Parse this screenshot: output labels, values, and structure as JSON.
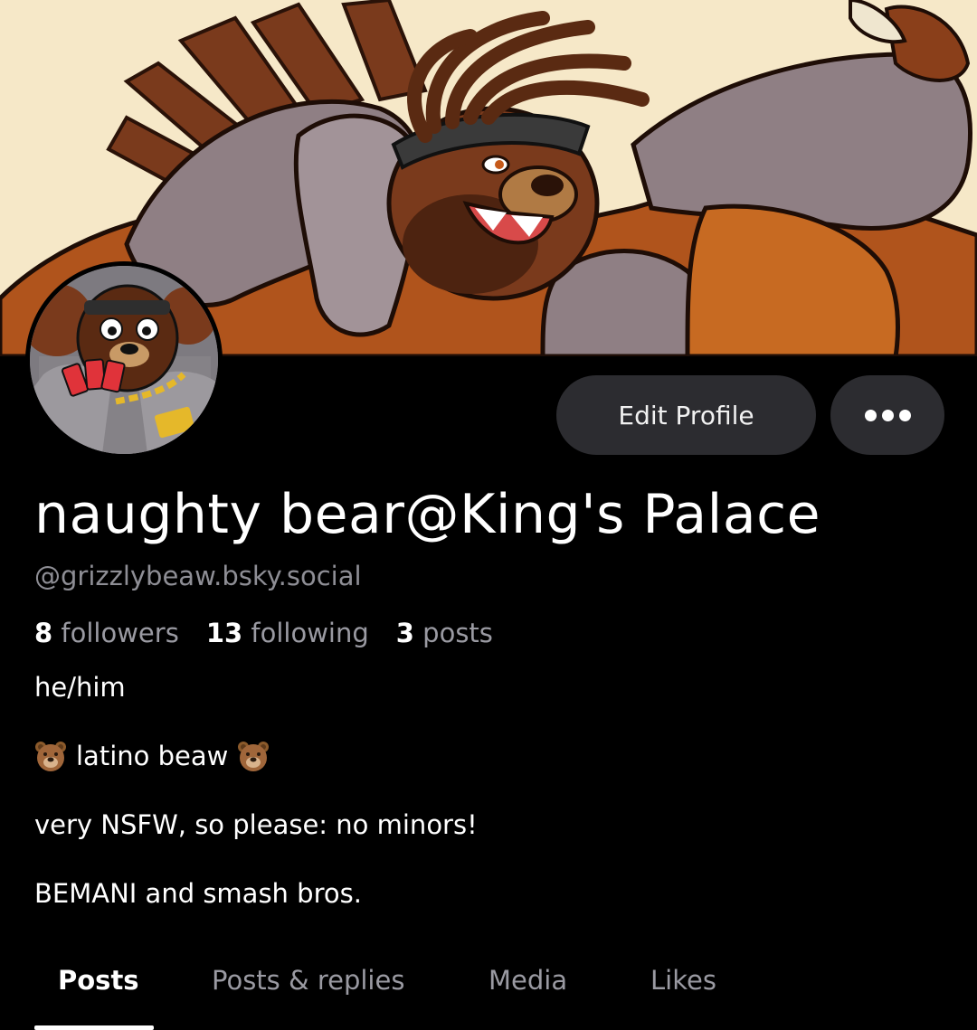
{
  "profile": {
    "display_name": "naughty bear@King's Palace",
    "handle": "@grizzlybeaw.bsky.social",
    "stats": [
      {
        "count": "8",
        "label": "followers"
      },
      {
        "count": "13",
        "label": "following"
      },
      {
        "count": "3",
        "label": "posts"
      }
    ],
    "bio": {
      "pronouns": "he/him",
      "tagline": "latino beaw",
      "tagline_emoji": "bear-face",
      "warning": "very NSFW, so please: no minors!",
      "interests": "BEMANI and smash bros."
    }
  },
  "actions": {
    "edit_profile_label": "Edit Profile",
    "more_icon": "ellipsis-icon"
  },
  "tabs": [
    {
      "label": "Posts",
      "active": true
    },
    {
      "label": "Posts & replies",
      "active": false
    },
    {
      "label": "Media",
      "active": false
    },
    {
      "label": "Likes",
      "active": false
    }
  ],
  "colors": {
    "background": "#000000",
    "button_bg": "#2c2c30",
    "muted_text": "#8e8e95",
    "banner_bg": "#f6e8c8"
  }
}
